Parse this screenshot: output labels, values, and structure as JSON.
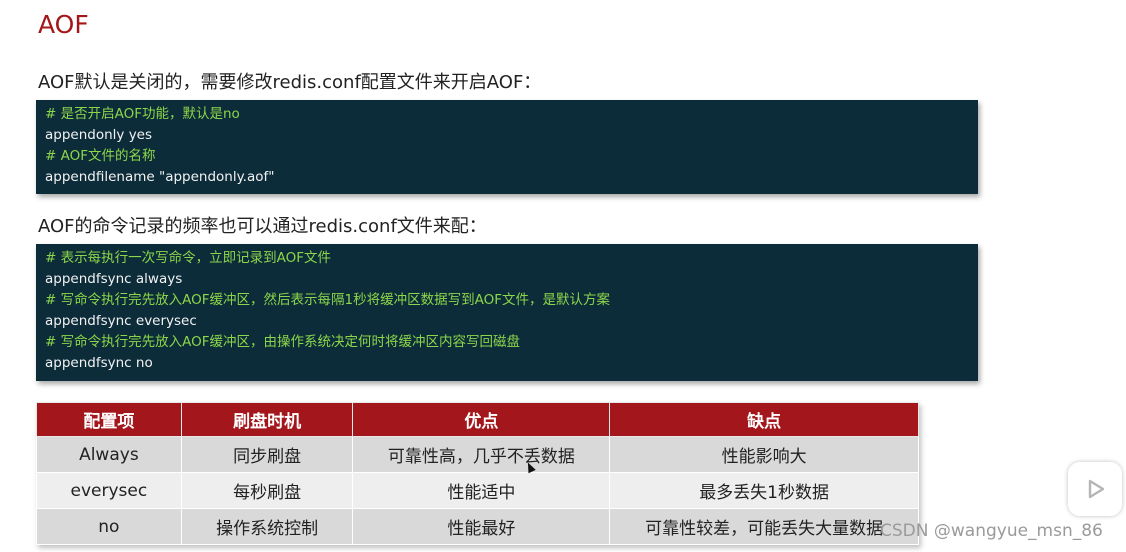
{
  "title": "AOF",
  "intro": "AOF默认是关闭的，需要修改redis.conf配置文件来开启AOF：",
  "code1": {
    "lines": [
      {
        "type": "comment",
        "text": "# 是否开启AOF功能，默认是no"
      },
      {
        "type": "cmd",
        "text": "appendonly yes"
      },
      {
        "type": "comment",
        "text": "# AOF文件的名称"
      },
      {
        "type": "cmd",
        "text": "appendfilename \"appendonly.aof\""
      }
    ]
  },
  "freq_text": "AOF的命令记录的频率也可以通过redis.conf文件来配：",
  "code2": {
    "lines": [
      {
        "type": "comment",
        "text": "# 表示每执行一次写命令，立即记录到AOF文件"
      },
      {
        "type": "cmd",
        "text": "appendfsync always"
      },
      {
        "type": "comment",
        "text": "# 写命令执行完先放入AOF缓冲区，然后表示每隔1秒将缓冲区数据写到AOF文件，是默认方案"
      },
      {
        "type": "cmd",
        "text": "appendfsync everysec"
      },
      {
        "type": "comment",
        "text": "# 写命令执行完先放入AOF缓冲区，由操作系统决定何时将缓冲区内容写回磁盘"
      },
      {
        "type": "cmd",
        "text": "appendfsync no"
      }
    ]
  },
  "table": {
    "headers": [
      "配置项",
      "刷盘时机",
      "优点",
      "缺点"
    ],
    "rows": [
      [
        "Always",
        "同步刷盘",
        "可靠性高，几乎不丢数据",
        "性能影响大"
      ],
      [
        "everysec",
        "每秒刷盘",
        "性能适中",
        "最多丢失1秒数据"
      ],
      [
        "no",
        "操作系统控制",
        "性能最好",
        "可靠性较差，可能丢失大量数据"
      ]
    ]
  },
  "watermark": "CSDN @wangyue_msn_86",
  "icons": {
    "play": "play-icon",
    "cursor": "mouse-cursor-icon"
  },
  "colors": {
    "title": "#a4161a",
    "code_bg": "#0c2c3a",
    "comment": "#8cd64a",
    "header_bg": "#a3161c"
  }
}
